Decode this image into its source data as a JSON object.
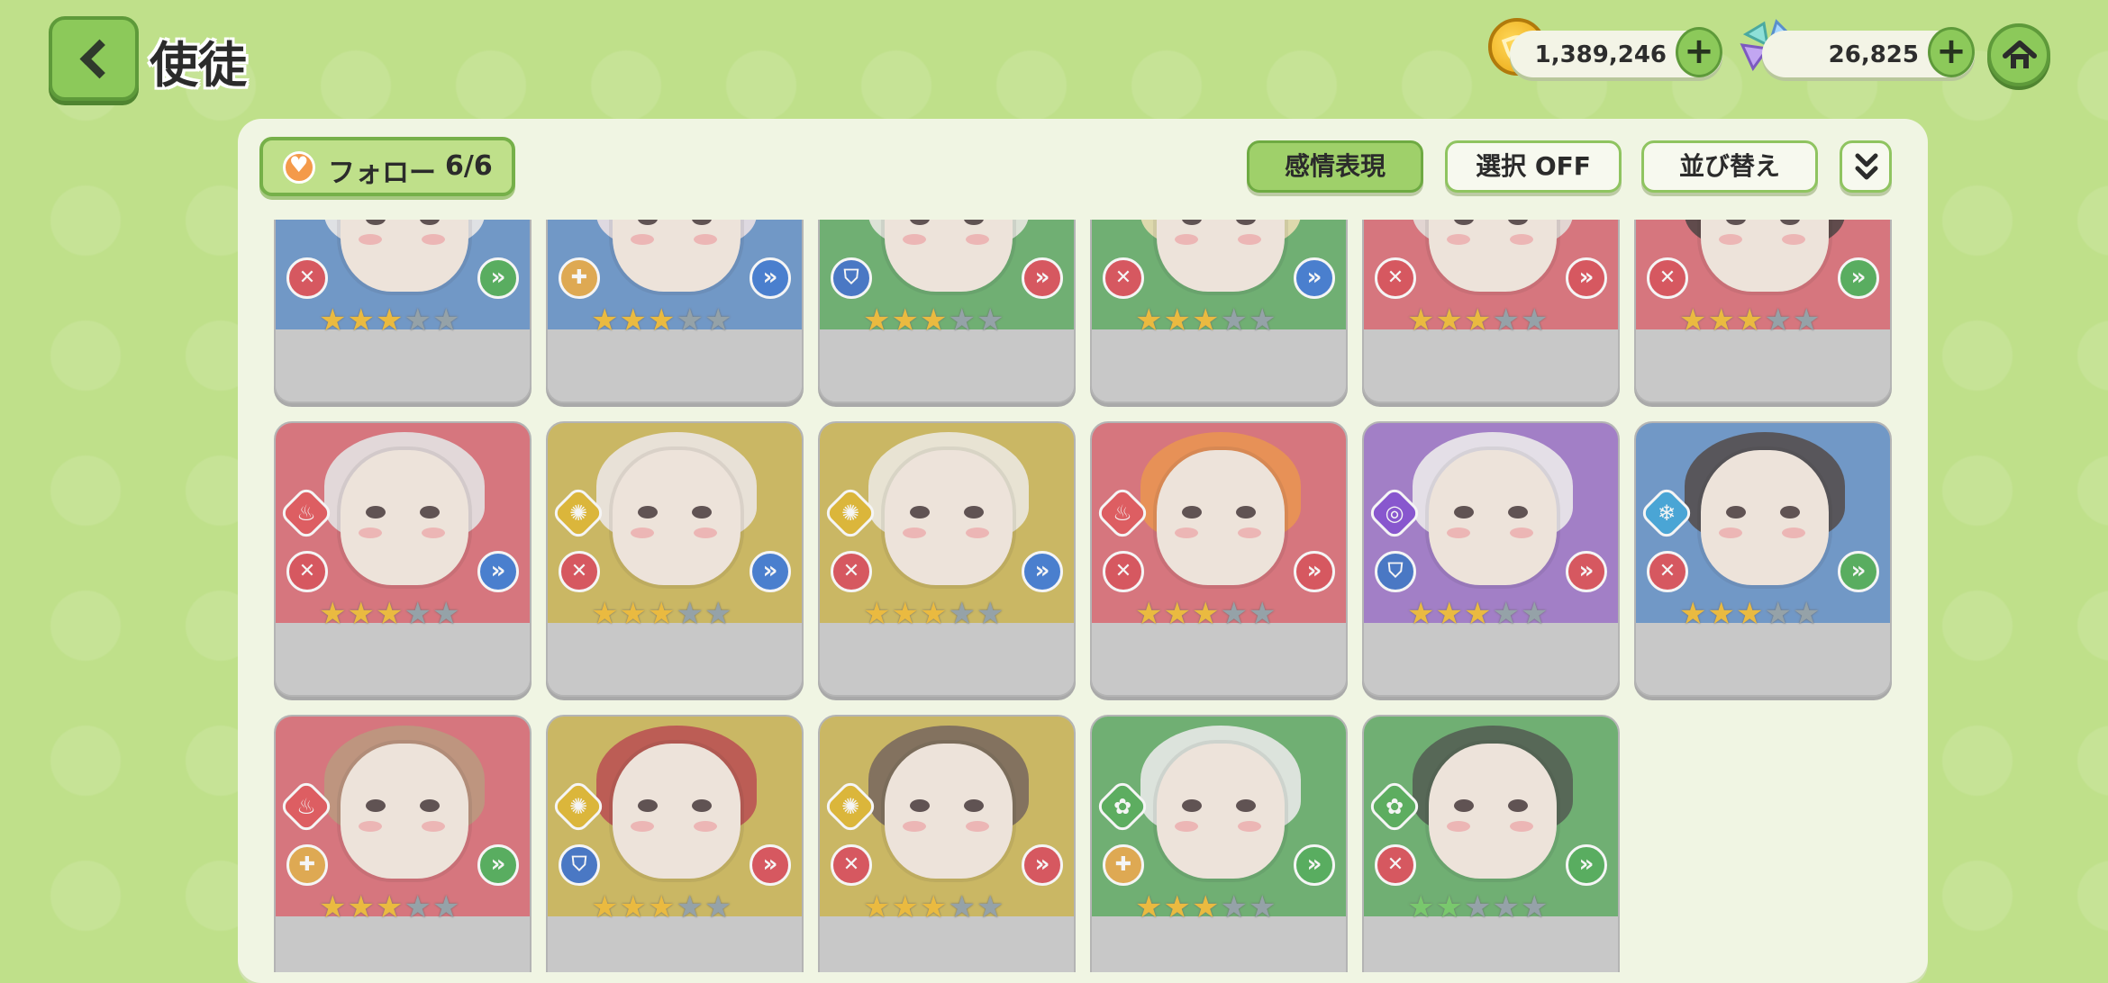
{
  "header": {
    "title": "使徒",
    "gold": "1,389,246",
    "gems": "26,825"
  },
  "toolbar": {
    "follow_label": "フォロー",
    "follow_count": "6/6",
    "emotion_label": "感情表現",
    "select_label": "選択 OFF",
    "sort_label": "並び替え"
  },
  "colors": {
    "background": "#bfe08a",
    "panel": "#f0f5e3",
    "accent_green": "#8cc95a",
    "card_red": "#d9646e",
    "card_yellow": "#cbb44f",
    "card_blue": "#5f8ec6",
    "card_green": "#5daa61",
    "card_purple": "#9a6fc6"
  },
  "cards": [
    {
      "bg": "card_blue",
      "element": "none",
      "role": "attack-icon",
      "arrow": "green",
      "stars": 3,
      "star_total": 5
    },
    {
      "bg": "card_blue",
      "element": "none",
      "role": "heal-icon",
      "arrow": "blue",
      "stars": 3,
      "star_total": 5
    },
    {
      "bg": "card_green",
      "element": "none",
      "role": "shield-icon",
      "arrow": "red",
      "stars": 3,
      "star_total": 5
    },
    {
      "bg": "card_green",
      "element": "none",
      "role": "attack-icon",
      "arrow": "blue",
      "stars": 3,
      "star_total": 5
    },
    {
      "bg": "card_red",
      "element": "none",
      "role": "attack-icon",
      "arrow": "red",
      "stars": 3,
      "star_total": 5
    },
    {
      "bg": "card_red",
      "element": "none",
      "role": "attack-icon",
      "arrow": "green",
      "stars": 3,
      "star_total": 5
    },
    {
      "bg": "card_red",
      "element": "fire-icon",
      "role": "attack-icon",
      "arrow": "blue",
      "stars": 3,
      "star_total": 5
    },
    {
      "bg": "card_yellow",
      "element": "sun-icon",
      "role": "attack-icon",
      "arrow": "blue",
      "stars": 3,
      "star_total": 5
    },
    {
      "bg": "card_yellow",
      "element": "sun-icon",
      "role": "attack-icon",
      "arrow": "blue",
      "stars": 3,
      "star_total": 5
    },
    {
      "bg": "card_red",
      "element": "fire-icon",
      "role": "attack-icon",
      "arrow": "red",
      "stars": 3,
      "star_total": 5
    },
    {
      "bg": "card_purple",
      "element": "swirl-icon",
      "role": "shield-icon",
      "arrow": "red",
      "stars": 3,
      "star_total": 5
    },
    {
      "bg": "card_blue",
      "element": "snow-icon",
      "role": "attack-icon",
      "arrow": "green",
      "stars": 3,
      "star_total": 5
    },
    {
      "bg": "card_red",
      "element": "fire-icon",
      "role": "heal-icon",
      "arrow": "green",
      "stars": 3,
      "star_total": 5
    },
    {
      "bg": "card_yellow",
      "element": "sun-icon",
      "role": "shield-icon",
      "arrow": "red",
      "stars": 3,
      "star_total": 5
    },
    {
      "bg": "card_yellow",
      "element": "sun-icon",
      "role": "attack-icon",
      "arrow": "red",
      "stars": 3,
      "star_total": 5
    },
    {
      "bg": "card_green",
      "element": "leaf-icon",
      "role": "heal-icon",
      "arrow": "green",
      "stars": 3,
      "star_total": 5
    },
    {
      "bg": "card_green",
      "element": "leaf-icon",
      "role": "attack-icon",
      "arrow": "green",
      "stars": 2,
      "star_total": 5,
      "star_color": "green"
    }
  ]
}
